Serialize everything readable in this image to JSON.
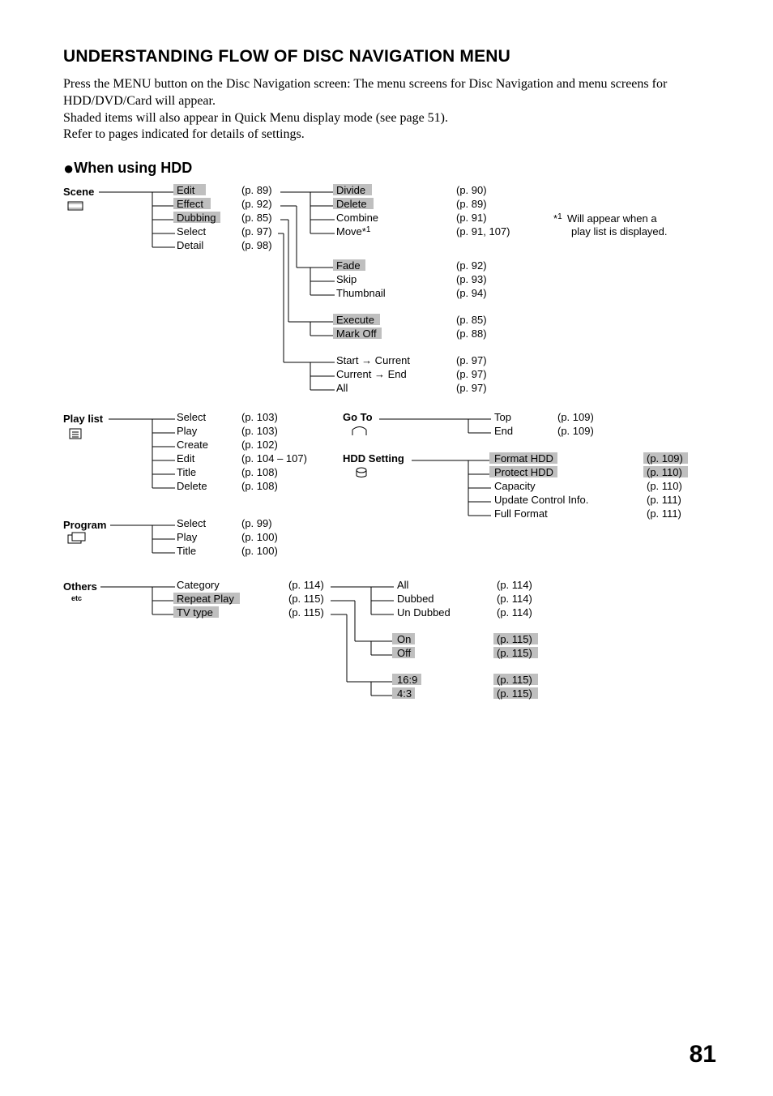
{
  "title": "UNDERSTANDING FLOW OF DISC NAVIGATION MENU",
  "intro_line1": "Press the MENU button on the Disc Navigation screen: The menu screens for Disc Navigation and menu screens for HDD/DVD/Card will appear.",
  "intro_line2": "Shaded items will also appear in Quick Menu display mode (see page 51).",
  "intro_line3": "Refer to pages indicated for details of settings.",
  "subheader": "When using HDD",
  "footnote": "Will appear when a play list is displayed.",
  "footnote_mark": "*1",
  "page_number": "81",
  "roots": {
    "scene": "Scene",
    "playlist": "Play list",
    "program": "Program",
    "others": "Others",
    "goto": "Go To",
    "hdd_setting": "HDD Setting"
  },
  "icons": {
    "others_label": "etc"
  },
  "scene_items": [
    {
      "label": "Edit",
      "page": "(p. 89)",
      "shaded": true
    },
    {
      "label": "Effect",
      "page": "(p. 92)",
      "shaded": true
    },
    {
      "label": "Dubbing",
      "page": "(p. 85)",
      "shaded": true
    },
    {
      "label": "Select",
      "page": "(p. 97)",
      "shaded": false
    },
    {
      "label": "Detail",
      "page": "(p. 98)",
      "shaded": false
    }
  ],
  "edit_children": [
    {
      "label": "Divide",
      "page": "(p. 90)",
      "shaded": true
    },
    {
      "label": "Delete",
      "page": "(p. 89)",
      "shaded": true
    },
    {
      "label": "Combine",
      "page": "(p. 91)",
      "shaded": false
    },
    {
      "label": "Move*1",
      "page": "(p. 91, 107)",
      "shaded": false
    }
  ],
  "effect_children": [
    {
      "label": "Fade",
      "page": "(p. 92)",
      "shaded": true
    },
    {
      "label": "Skip",
      "page": "(p. 93)",
      "shaded": false
    },
    {
      "label": "Thumbnail",
      "page": "(p. 94)",
      "shaded": false
    }
  ],
  "dubbing_children": [
    {
      "label": "Execute",
      "page": "(p. 85)",
      "shaded": true
    },
    {
      "label": "Mark Off",
      "page": "(p. 88)",
      "shaded": true
    }
  ],
  "select_children": [
    {
      "label": "Start → Current",
      "page": "(p. 97)"
    },
    {
      "label": "Current → End",
      "page": "(p. 97)"
    },
    {
      "label": "All",
      "page": "(p. 97)"
    }
  ],
  "playlist_items": [
    {
      "label": "Select",
      "page": "(p. 103)"
    },
    {
      "label": "Play",
      "page": "(p. 103)"
    },
    {
      "label": "Create",
      "page": "(p. 102)"
    },
    {
      "label": "Edit",
      "page": "(p. 104 – 107)"
    },
    {
      "label": "Title",
      "page": "(p. 108)"
    },
    {
      "label": "Delete",
      "page": "(p. 108)"
    }
  ],
  "goto_items": [
    {
      "label": "Top",
      "page": "(p. 109)"
    },
    {
      "label": "End",
      "page": "(p. 109)"
    }
  ],
  "hdd_setting_items": [
    {
      "label": "Format HDD",
      "page": "(p. 109)",
      "shaded": true
    },
    {
      "label": "Protect HDD",
      "page": "(p. 110)",
      "shaded": true
    },
    {
      "label": "Capacity",
      "page": "(p. 110)",
      "shaded": false
    },
    {
      "label": "Update Control Info.",
      "page": "(p. 111)",
      "shaded": false
    },
    {
      "label": "Full Format",
      "page": "(p. 111)",
      "shaded": false
    }
  ],
  "program_items": [
    {
      "label": "Select",
      "page": "(p. 99)"
    },
    {
      "label": "Play",
      "page": "(p. 100)"
    },
    {
      "label": "Title",
      "page": "(p. 100)"
    }
  ],
  "others_items": [
    {
      "label": "Category",
      "page": "(p. 114)",
      "shaded": false
    },
    {
      "label": "Repeat Play",
      "page": "(p. 115)",
      "shaded": true
    },
    {
      "label": "TV type",
      "page": "(p. 115)",
      "shaded": true
    }
  ],
  "category_children": [
    {
      "label": "All",
      "page": "(p. 114)"
    },
    {
      "label": "Dubbed",
      "page": "(p. 114)"
    },
    {
      "label": "Un Dubbed",
      "page": "(p. 114)"
    }
  ],
  "repeat_children": [
    {
      "label": "On",
      "page": "(p. 115)",
      "shaded": true
    },
    {
      "label": "Off",
      "page": "(p. 115)",
      "shaded": true
    }
  ],
  "tv_children": [
    {
      "label": "16:9",
      "page": "(p. 115)",
      "shaded": true
    },
    {
      "label": "4:3",
      "page": "(p. 115)",
      "shaded": true
    }
  ]
}
